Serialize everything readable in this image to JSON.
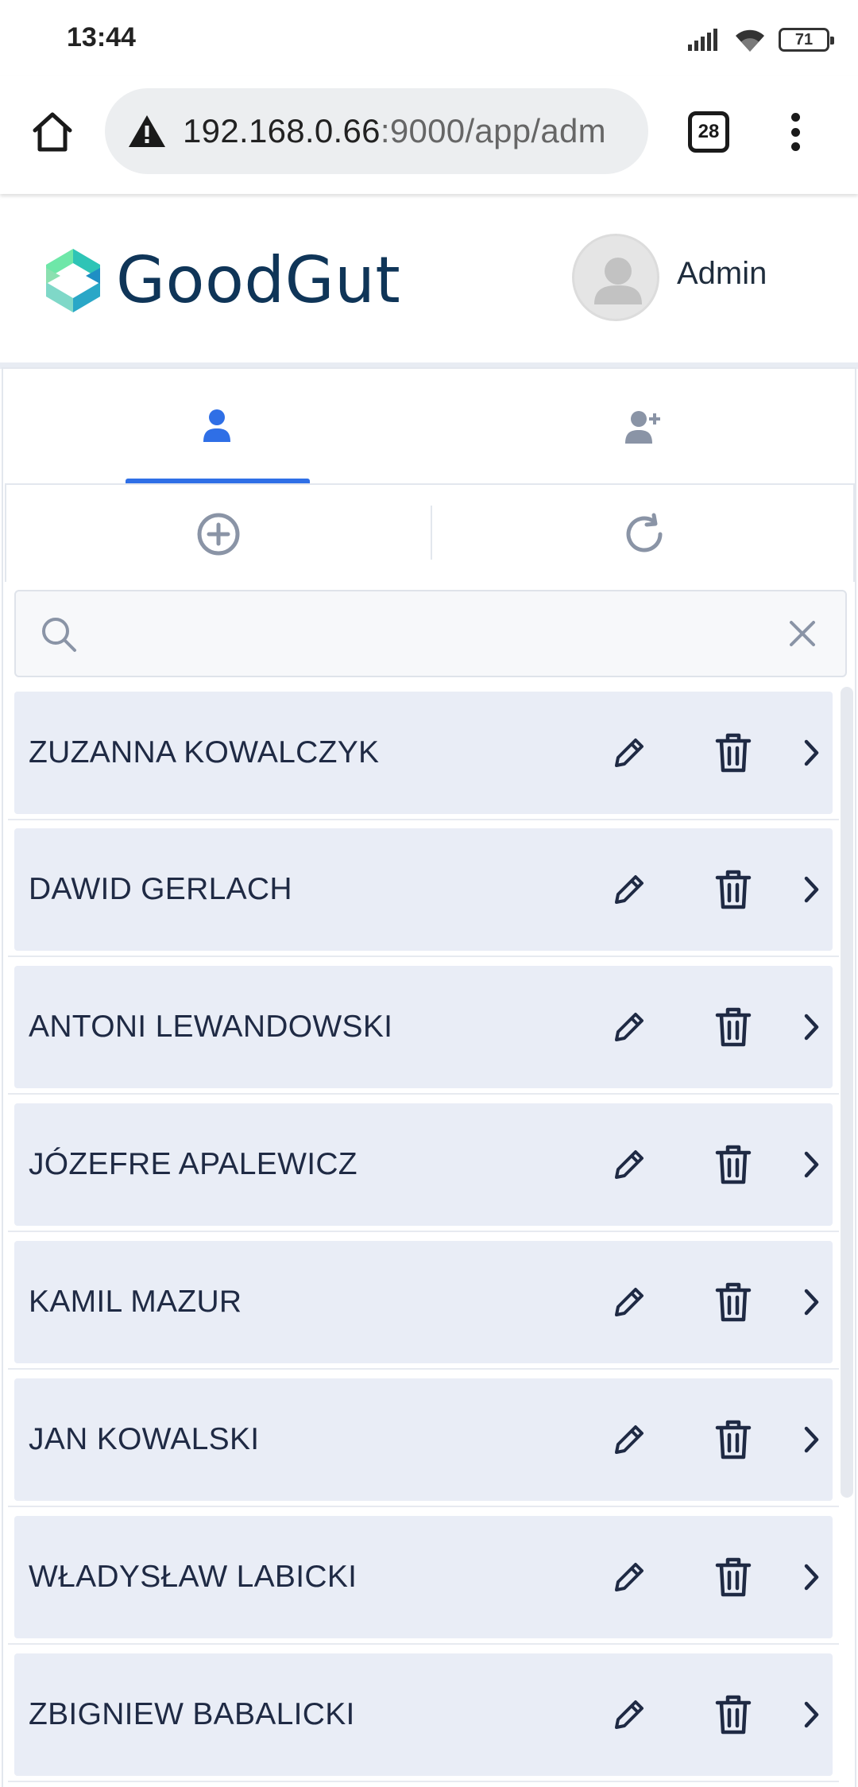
{
  "status_bar": {
    "time": "13:44",
    "battery": "71",
    "icons": [
      "signal-icon",
      "wifi-icon",
      "battery-icon"
    ]
  },
  "browser": {
    "url_host": "192.168.0.66",
    "url_path": ":9000/app/adm",
    "tab_count": "28",
    "icons": [
      "home-icon",
      "warning-icon",
      "tabs-icon",
      "more-vert-icon"
    ]
  },
  "app": {
    "name": "GoodGut",
    "user_label": "Admin",
    "tabs": [
      {
        "icon": "user-icon",
        "active": true
      },
      {
        "icon": "user-plus-icon",
        "active": false
      }
    ],
    "toolbar": {
      "icons": [
        "add-circle-icon",
        "refresh-icon"
      ]
    },
    "search": {
      "value": "",
      "placeholder": ""
    },
    "colors": {
      "accent": "#2f6fe6",
      "row_bg": "#e9edf6",
      "icon_gray": "#8a94a6",
      "brand_text": "#0f3558"
    }
  },
  "users": [
    {
      "name": "ZUZANNA KOWALCZYK"
    },
    {
      "name": "DAWID GERLACH"
    },
    {
      "name": "ANTONI LEWANDOWSKI"
    },
    {
      "name": "JÓZEFRE APALEWICZ"
    },
    {
      "name": "KAMIL MAZUR"
    },
    {
      "name": "JAN KOWALSKI"
    },
    {
      "name": "WŁADYSŁAW LABICKI"
    },
    {
      "name": "ZBIGNIEW BABALICKI"
    }
  ],
  "row_icons": [
    "pencil-icon",
    "trash-icon",
    "chevron-right-icon"
  ]
}
